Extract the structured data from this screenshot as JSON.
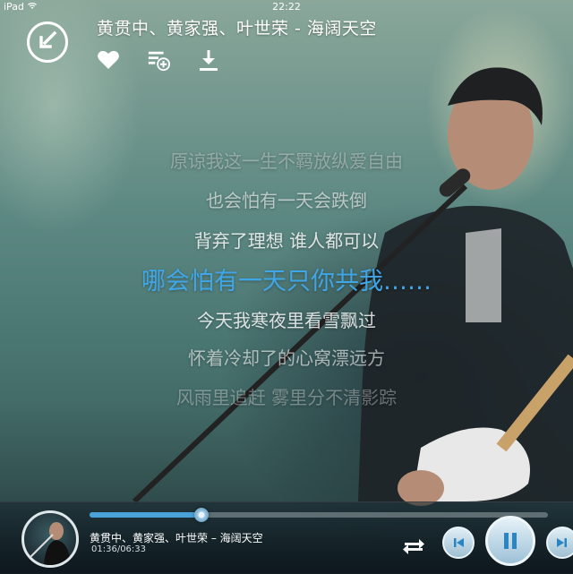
{
  "status_bar": {
    "device": "iPad",
    "time": "22:22"
  },
  "header": {
    "title": "黄贯中、黄家强、叶世荣 - 海阔天空"
  },
  "icons": {
    "back": "back-arrow-icon",
    "favorite": "heart-icon",
    "add_to_playlist": "playlist-add-icon",
    "download": "download-icon"
  },
  "lyrics": [
    {
      "text": "原谅我这一生不羁放纵爱自由",
      "state": "past"
    },
    {
      "text": "也会怕有一天会跌倒",
      "state": "past"
    },
    {
      "text": "背弃了理想 谁人都可以",
      "state": "past"
    },
    {
      "text": "哪会怕有一天只你共我……",
      "state": "current"
    },
    {
      "text": "今天我寒夜里看雪飘过",
      "state": "upcoming"
    },
    {
      "text": "怀着冷却了的心窝漂远方",
      "state": "upcoming"
    },
    {
      "text": "风雨里追赶 雾里分不清影踪",
      "state": "upcoming"
    }
  ],
  "colors": {
    "current_lyric": "#3fa6e8",
    "progress": "#4aa3d8"
  },
  "player": {
    "title": "黄贯中、黄家强、叶世荣 – 海阔天空",
    "time": "01:36/06:33",
    "progress": 0.244
  }
}
